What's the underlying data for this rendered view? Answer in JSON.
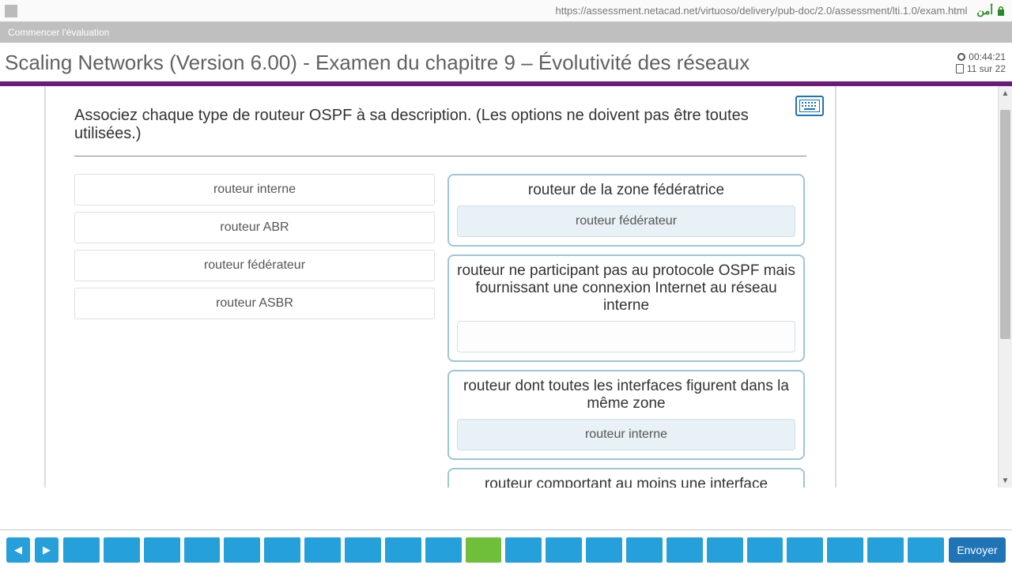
{
  "browser": {
    "url": "https://assessment.netacad.net/virtuoso/delivery/pub-doc/2.0/assessment/lti.1.0/exam.html",
    "security_label": "أمن"
  },
  "subbar": {
    "start_label": "Commencer l'évaluation"
  },
  "header": {
    "title": "Scaling Networks (Version 6.00) - Examen du chapitre 9 – Évolutivité des réseaux",
    "timer": "00:44:21",
    "progress": "11 sur 22"
  },
  "question": {
    "prompt": "Associez chaque type de routeur OSPF à sa description. (Les options ne doivent pas être toutes utilisées.)",
    "sources": [
      "routeur interne",
      "routeur ABR",
      "routeur fédérateur",
      "routeur ASBR"
    ],
    "targets": [
      {
        "title": "routeur de la zone fédératrice",
        "answer": "routeur fédérateur"
      },
      {
        "title": "routeur ne participant pas au protocole OSPF mais fournissant une connexion Internet au réseau interne",
        "answer": ""
      },
      {
        "title": "routeur dont toutes les interfaces figurent dans la même zone",
        "answer": "routeur interne"
      },
      {
        "title": "routeur comportant au moins une interface connectée à un réseau non OSPF",
        "answer": ""
      }
    ]
  },
  "nav": {
    "total_tiles": 22,
    "active_index": 11,
    "submit_label": "Envoyer"
  }
}
